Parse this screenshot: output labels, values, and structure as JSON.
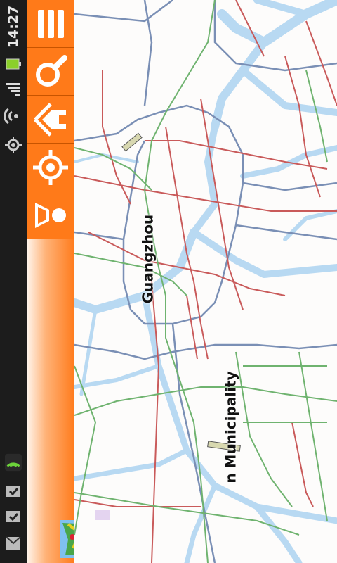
{
  "status_bar": {
    "time": "14:27",
    "icons": [
      "battery-icon",
      "signal-icon",
      "wifi-icon",
      "gps-icon",
      "notification-app-icon",
      "download-done-icon",
      "download-done-icon",
      "gmail-icon"
    ]
  },
  "toolbar": {
    "buttons": [
      "menu-icon",
      "search-icon",
      "home-icon",
      "locate-icon",
      "layers-icon"
    ],
    "app_thumbnail": "map-thumbnail-icon"
  },
  "map": {
    "labels": {
      "city": "Guangzhou",
      "municipality": "n Municipality"
    }
  },
  "colors": {
    "toolbar_orange": "#ff7a19",
    "water": "#b8d9f2",
    "road_red": "#c95a5a",
    "road_green": "#6fb36f",
    "road_blue": "#7a8fb5"
  }
}
